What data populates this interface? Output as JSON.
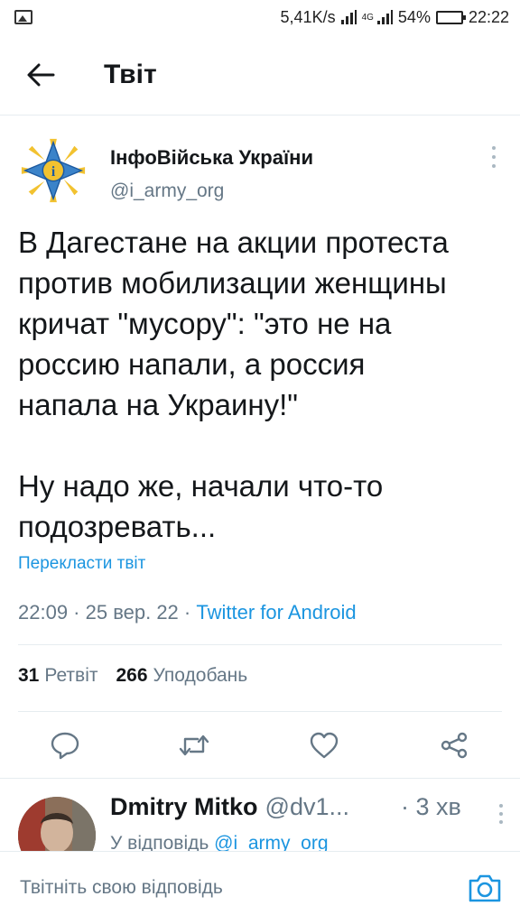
{
  "status_bar": {
    "speed": "5,41K/s",
    "network": "4G",
    "battery": "54%",
    "battery_level": 0.54,
    "time": "22:22"
  },
  "header": {
    "title": "Твіт",
    "back_icon": "arrow-left-icon"
  },
  "tweet": {
    "author_name": "ІнфоВійська України",
    "author_handle": "@i_army_org",
    "text_lines": [
      "В Дагестане на акции протеста",
      "против мобилизации женщины",
      "кричат \"мусору\": \"это не на",
      "россию напали, а россия",
      "напала на Украину!\"",
      "",
      "Ну надо же, начали что-то",
      "подозревать..."
    ],
    "translate_label": "Перекласти твіт",
    "timestamp": "22:09 · 25 вер. 22 · ",
    "source": "Twitter for Android",
    "retweets_count": "31",
    "retweets_label": "Ретвіт",
    "likes_count": "266",
    "likes_label": "Уподобань"
  },
  "actions": {
    "reply_icon": "reply-icon",
    "retweet_icon": "retweet-icon",
    "like_icon": "heart-icon",
    "share_icon": "share-icon"
  },
  "reply": {
    "name": "Dmitry Mitko",
    "handle": "@dv1...",
    "time": "· 3 хв",
    "reply_to_prefix": "У відповідь ",
    "reply_to_handle": "@i_army_org"
  },
  "composer": {
    "placeholder": "Твітніть свою відповідь",
    "camera_icon": "camera-icon"
  },
  "colors": {
    "accent": "#1b95e0",
    "secondary_text": "#657786",
    "divider": "#e6ecf0"
  }
}
